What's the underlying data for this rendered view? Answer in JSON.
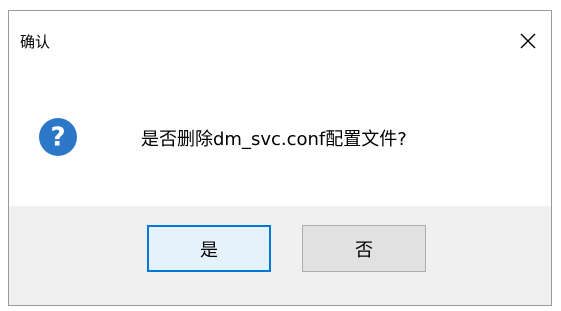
{
  "dialog": {
    "title": "确认",
    "message": "是否删除dm_svc.conf配置文件?",
    "icon": "question-icon",
    "buttons": {
      "yes_label": "是",
      "no_label": "否"
    }
  },
  "colors": {
    "accent": "#0078d7",
    "icon_blue": "#2d77c8",
    "button_face": "#e1e1e1",
    "content_bg": "#ffffff",
    "footer_bg": "#f0f0f0"
  }
}
